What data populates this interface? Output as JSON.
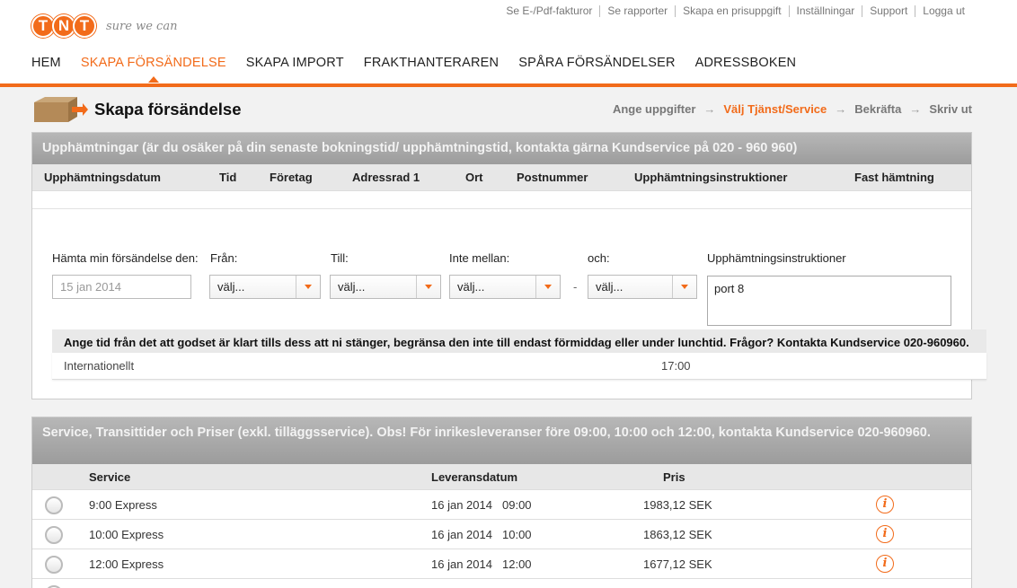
{
  "header": {
    "logo_text": "TNT",
    "slogan": "sure we can",
    "top_links": [
      "Se E-/Pdf-fakturor",
      "Se rapporter",
      "Skapa en prisuppgift",
      "Inställningar",
      "Support",
      "Logga ut"
    ],
    "nav": [
      "HEM",
      "SKAPA FÖRSÄNDELSE",
      "SKAPA IMPORT",
      "FRAKTHANTERAREN",
      "SPÅRA FÖRSÄNDELSER",
      "ADRESSBOKEN"
    ],
    "active_nav": "SKAPA FÖRSÄNDELSE"
  },
  "page": {
    "title": "Skapa försändelse",
    "steps": [
      "Ange uppgifter",
      "Välj Tjänst/Service",
      "Bekräfta",
      "Skriv ut"
    ],
    "current_step": "Välj Tjänst/Service"
  },
  "pickups": {
    "heading": "Upphämtningar (är du osäker på din senaste bokningstid/ upphämtningstid, kontakta gärna Kundservice på 020 - 960 960)",
    "columns": [
      "Upphämtningsdatum",
      "Tid",
      "Företag",
      "Adressrad 1",
      "Ort",
      "Postnummer",
      "Upphämtningsinstruktioner",
      "Fast hämtning"
    ],
    "form": {
      "date_label": "Hämta min försändelse den:",
      "date_placeholder": "15 jan 2014",
      "from_label": "Från:",
      "from_value": "välj...",
      "to_label": "Till:",
      "to_value": "välj...",
      "not_between_label": "Inte mellan:",
      "not_between_value": "välj...",
      "dash": "-",
      "and_label": "och:",
      "and_value": "välj...",
      "instructions_label": "Upphämtningsinstruktioner",
      "instructions_value": "port 8"
    },
    "notice": "Ange tid från det att godset är klart tills dess att ni stänger, begränsa den inte till endast förmiddag eller under lunchtid. Frågor? Kontakta Kundservice 020-960960.",
    "intl_row": {
      "label": "Internationellt",
      "time": "17:00"
    }
  },
  "services": {
    "heading": "Service, Transittider och Priser (exkl. tilläggsservice). Obs! För inrikesleveranser före 09:00, 10:00 och 12:00, kontakta Kundservice 020-960960.",
    "columns": [
      "Service",
      "Leveransdatum",
      "Pris"
    ],
    "rows": [
      {
        "service": "9:00 Express",
        "date": "16 jan 2014",
        "time": "09:00",
        "price": "1983,12 SEK"
      },
      {
        "service": "10:00 Express",
        "date": "16 jan 2014",
        "time": "10:00",
        "price": "1863,12 SEK"
      },
      {
        "service": "12:00 Express",
        "date": "16 jan 2014",
        "time": "12:00",
        "price": "1677,12 SEK"
      }
    ],
    "info_icon": "info-icon"
  },
  "colors": {
    "brand": "#f26b1a",
    "panel_head": "#a8a8a8"
  }
}
